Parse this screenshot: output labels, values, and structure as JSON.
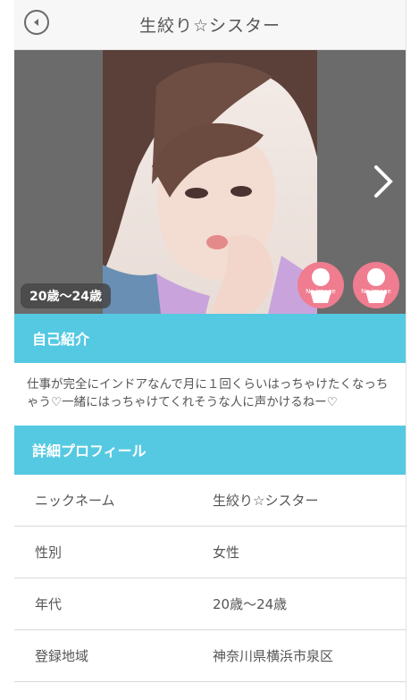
{
  "header": {
    "title": "生絞り☆シスター",
    "back_icon": "back-arrow-icon"
  },
  "gallery": {
    "age_badge": "20歳〜24歳",
    "thumbnails": [
      {
        "label": "No Image",
        "icon": "person-placeholder-icon"
      },
      {
        "label": "No Image",
        "icon": "person-placeholder-icon"
      }
    ],
    "next_icon": "chevron-right-icon",
    "colors": {
      "background": "#6b6b6b",
      "thumb": "#f07c8f"
    }
  },
  "intro": {
    "heading": "自己紹介",
    "text": "仕事が完全にインドアなんで月に１回くらいはっちゃけたくなっちゃう♡一緒にはっちゃけてくれそうな人に声かけるねー♡"
  },
  "profile": {
    "heading": "詳細プロフィール",
    "rows": [
      {
        "label": "ニックネーム",
        "value": "生絞り☆シスター"
      },
      {
        "label": "性別",
        "value": "女性"
      },
      {
        "label": "年代",
        "value": "20歳〜24歳"
      },
      {
        "label": "登録地域",
        "value": "神奈川県横浜市泉区"
      }
    ]
  },
  "colors": {
    "accent": "#55c9e2",
    "header_bg": "#f7f7f7"
  }
}
